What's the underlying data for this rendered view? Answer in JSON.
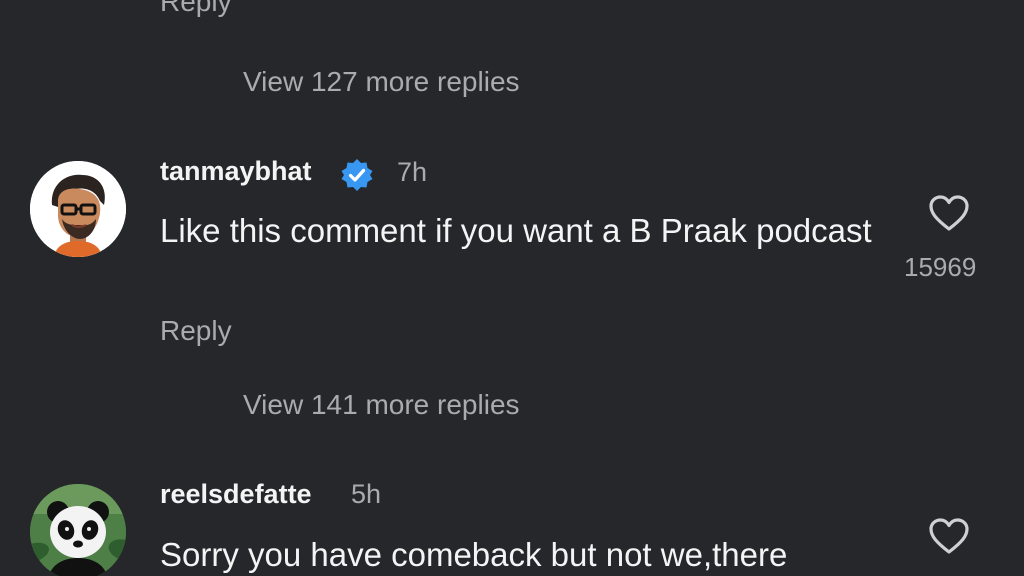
{
  "thread": {
    "reply_label": "Reply",
    "view_more_1": "View 127 more replies",
    "view_more_2": "View 141 more replies"
  },
  "comments": [
    {
      "username": "tanmaybhat",
      "verified": true,
      "time": "7h",
      "text": "Like this comment if you want a B Praak podcast",
      "reply_label": "Reply",
      "likes": "15969",
      "avatar_icon": "avatar-cartoon-glasses"
    },
    {
      "username": "reelsdefatte",
      "verified": false,
      "time": "5h",
      "text": "Sorry you have comeback but not we,there",
      "avatar_icon": "avatar-panda"
    }
  ],
  "colors": {
    "background": "#25272b",
    "primary_text": "#f4f4f4",
    "secondary_text": "#a9abb0",
    "verified_badge": "#3897f0"
  }
}
